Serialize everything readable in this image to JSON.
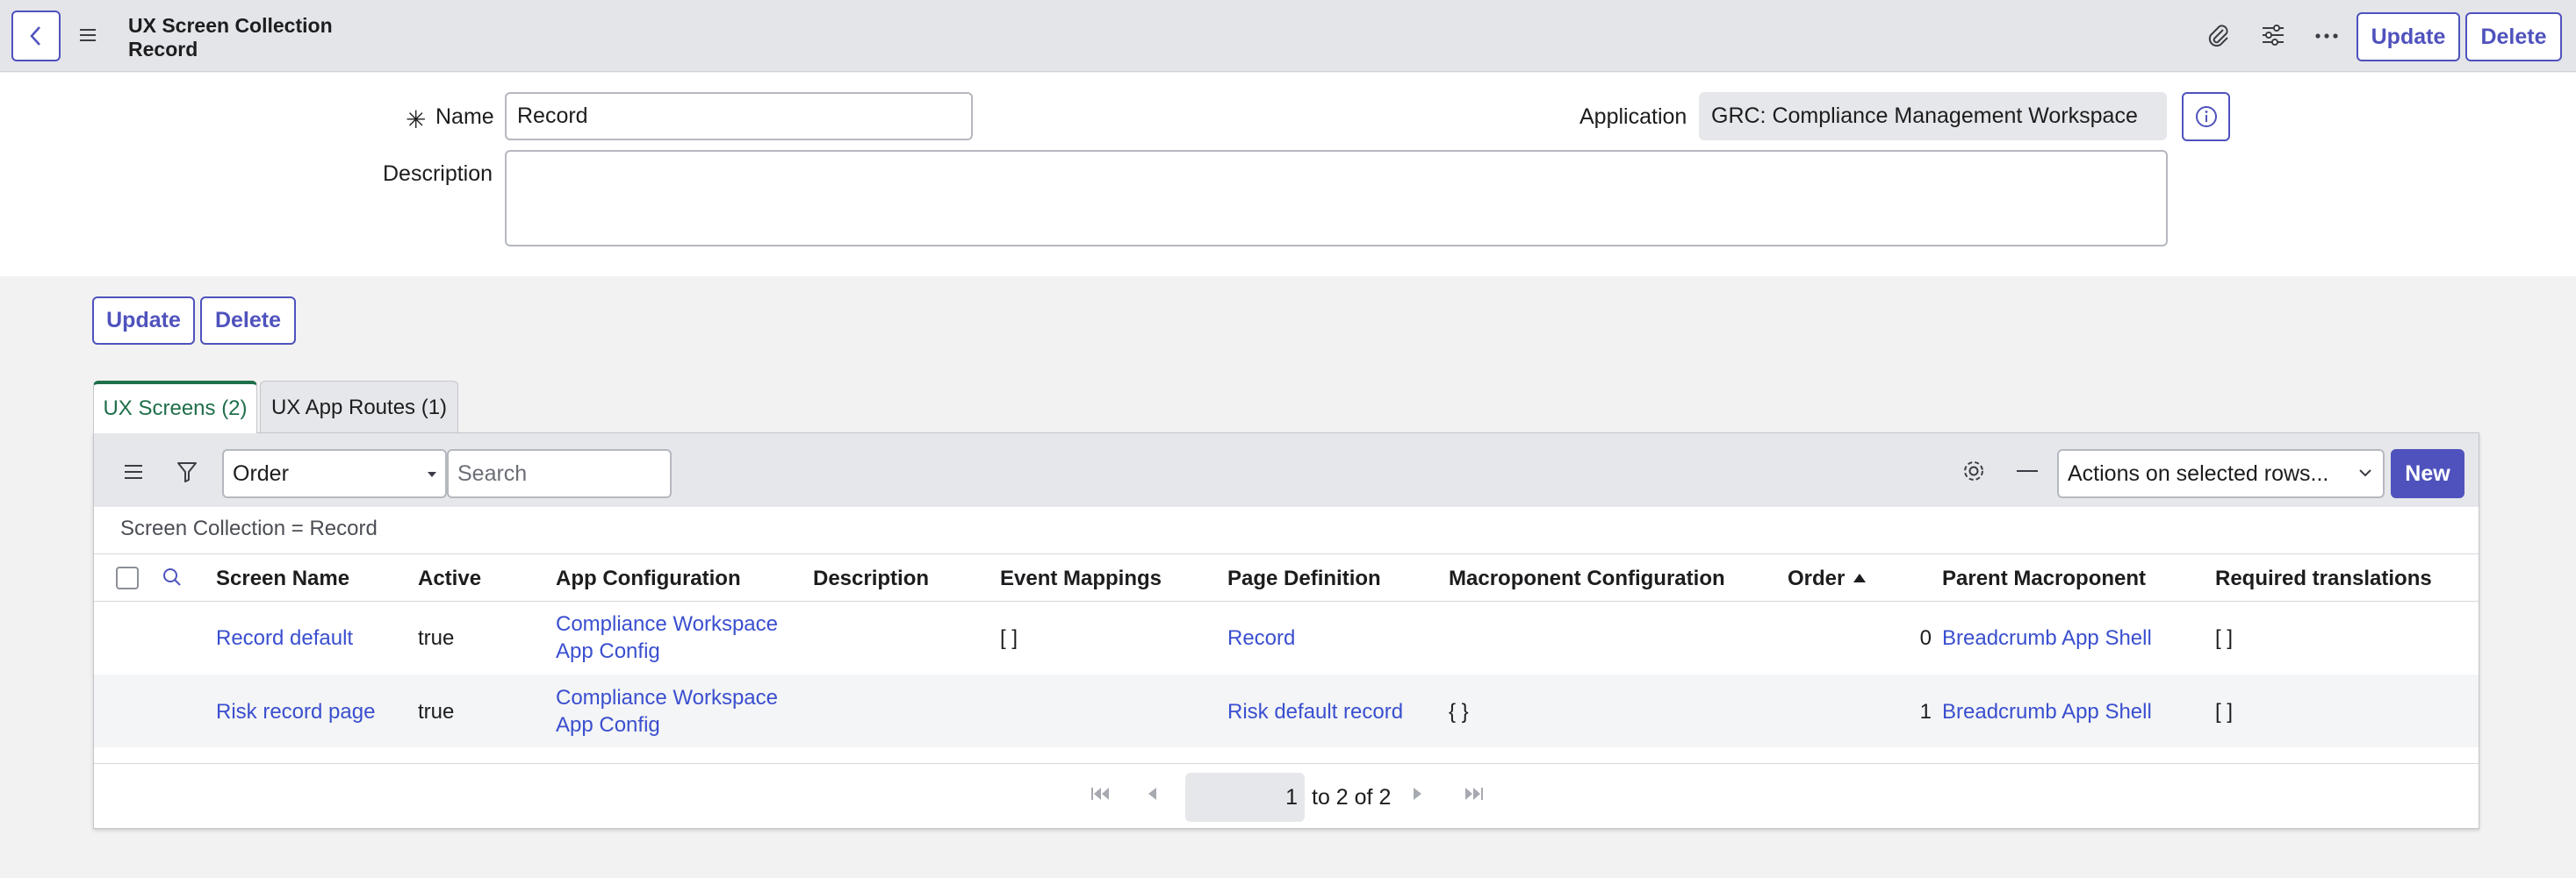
{
  "header": {
    "title_line1": "UX Screen Collection",
    "title_line2": "Record",
    "update_label": "Update",
    "delete_label": "Delete"
  },
  "form": {
    "name_label": "Name",
    "name_value": "Record",
    "application_label": "Application",
    "application_value": "GRC: Compliance Management Workspace",
    "description_label": "Description",
    "description_value": ""
  },
  "actions": {
    "update_label": "Update",
    "delete_label": "Delete"
  },
  "tabs": [
    {
      "label": "UX Screens (2)",
      "active": true
    },
    {
      "label": "UX App Routes (1)",
      "active": false
    }
  ],
  "list": {
    "order_select": "Order",
    "search_placeholder": "Search",
    "actions_select": "Actions on selected rows...",
    "new_label": "New",
    "filter_text": "Screen Collection = Record",
    "columns": [
      "Screen Name",
      "Active",
      "App Configuration",
      "Description",
      "Event Mappings",
      "Page Definition",
      "Macroponent Configuration",
      "Order",
      "Parent Macroponent",
      "Required translations"
    ],
    "rows": [
      {
        "screen_name": "Record default",
        "active": "true",
        "app_config_l1": "Compliance Workspace",
        "app_config_l2": "App Config",
        "description": "",
        "event_mappings": "[ ]",
        "page_definition": "Record",
        "macroponent_config": "",
        "order": "0",
        "parent_macroponent": "Breadcrumb App Shell",
        "required_translations": "[ ]"
      },
      {
        "screen_name": "Risk record page",
        "active": "true",
        "app_config_l1": "Compliance Workspace",
        "app_config_l2": "App Config",
        "description": "",
        "event_mappings": "",
        "page_definition": "Risk default record",
        "macroponent_config": "{ }",
        "order": "1",
        "parent_macroponent": "Breadcrumb App Shell",
        "required_translations": "[ ]"
      }
    ],
    "pagination": {
      "current_page": "1",
      "range_text": "to 2 of 2"
    }
  },
  "colors": {
    "accent": "#4f52bd",
    "link": "#3a4fcf",
    "active_tab": "#1f6f4a"
  }
}
